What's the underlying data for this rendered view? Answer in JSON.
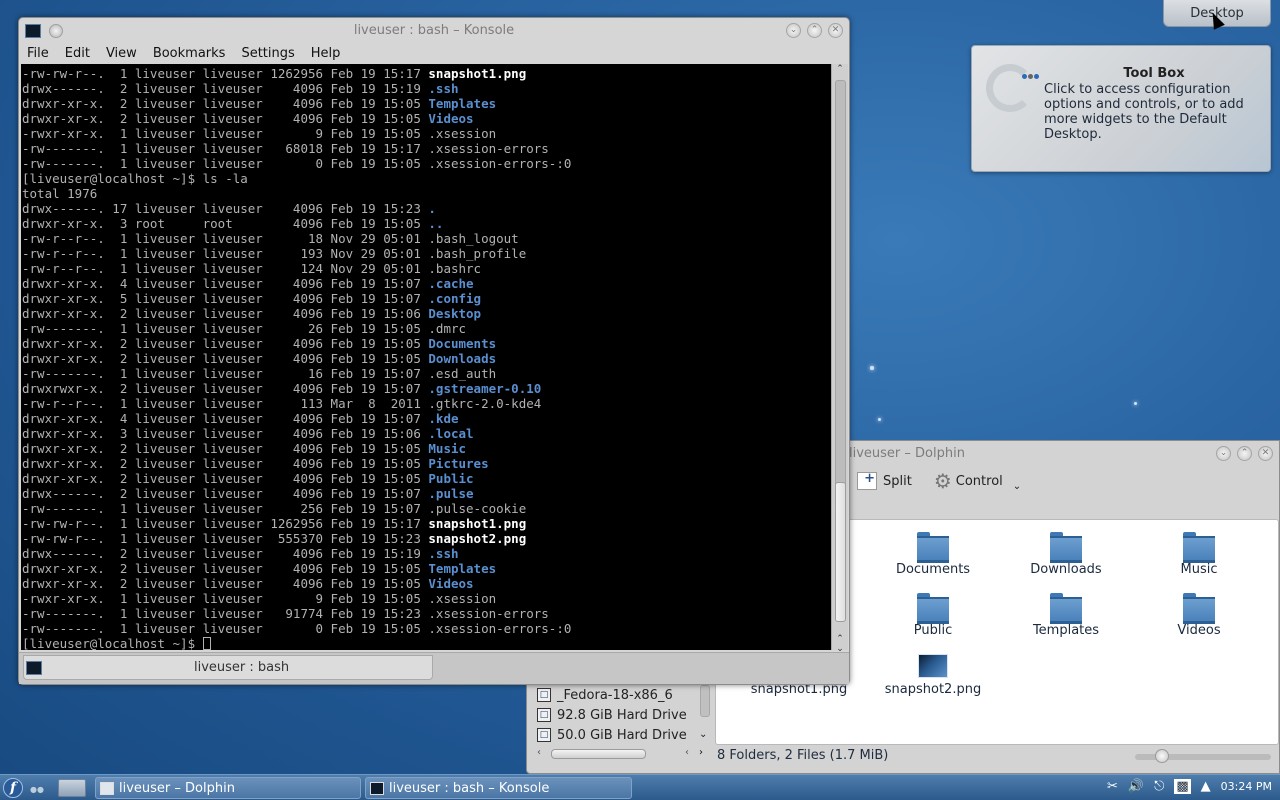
{
  "desktop": {
    "cashew_label": "Desktop",
    "toolbox": {
      "title": "Tool Box",
      "text": "Click to access configuration options and controls, or to add more widgets to the Default Desktop."
    }
  },
  "konsole": {
    "title": "liveuser : bash – Konsole",
    "menu": [
      "File",
      "Edit",
      "View",
      "Bookmarks",
      "Settings",
      "Help"
    ],
    "tab_label": "liveuser : bash",
    "lines": [
      {
        "t": "-rw-rw-r--.  1 liveuser liveuser 1262956 Feb 19 15:17 ",
        "n": "snapshot1.png",
        "k": "bold"
      },
      {
        "t": "drwx------.  2 liveuser liveuser    4096 Feb 19 15:19 ",
        "n": ".ssh",
        "k": "dir"
      },
      {
        "t": "drwxr-xr-x.  2 liveuser liveuser    4096 Feb 19 15:05 ",
        "n": "Templates",
        "k": "dir"
      },
      {
        "t": "drwxr-xr-x.  2 liveuser liveuser    4096 Feb 19 15:05 ",
        "n": "Videos",
        "k": "dir"
      },
      {
        "t": "-rwxr-xr-x.  1 liveuser liveuser       9 Feb 19 15:05 ",
        "n": ".xsession",
        "k": ""
      },
      {
        "t": "-rw-------.  1 liveuser liveuser   68018 Feb 19 15:17 ",
        "n": ".xsession-errors",
        "k": ""
      },
      {
        "t": "-rw-------.  1 liveuser liveuser       0 Feb 19 15:05 ",
        "n": ".xsession-errors-:0",
        "k": ""
      },
      {
        "t": "[liveuser@localhost ~]$ ls -la",
        "n": "",
        "k": ""
      },
      {
        "t": "total 1976",
        "n": "",
        "k": ""
      },
      {
        "t": "drwx------. 17 liveuser liveuser    4096 Feb 19 15:23 ",
        "n": ".",
        "k": "dir"
      },
      {
        "t": "drwxr-xr-x.  3 root     root        4096 Feb 19 15:05 ",
        "n": "..",
        "k": "dir"
      },
      {
        "t": "-rw-r--r--.  1 liveuser liveuser      18 Nov 29 05:01 ",
        "n": ".bash_logout",
        "k": ""
      },
      {
        "t": "-rw-r--r--.  1 liveuser liveuser     193 Nov 29 05:01 ",
        "n": ".bash_profile",
        "k": ""
      },
      {
        "t": "-rw-r--r--.  1 liveuser liveuser     124 Nov 29 05:01 ",
        "n": ".bashrc",
        "k": ""
      },
      {
        "t": "drwxr-xr-x.  4 liveuser liveuser    4096 Feb 19 15:07 ",
        "n": ".cache",
        "k": "dir"
      },
      {
        "t": "drwxr-xr-x.  5 liveuser liveuser    4096 Feb 19 15:07 ",
        "n": ".config",
        "k": "dir"
      },
      {
        "t": "drwxr-xr-x.  2 liveuser liveuser    4096 Feb 19 15:06 ",
        "n": "Desktop",
        "k": "dir"
      },
      {
        "t": "-rw-------.  1 liveuser liveuser      26 Feb 19 15:05 ",
        "n": ".dmrc",
        "k": ""
      },
      {
        "t": "drwxr-xr-x.  2 liveuser liveuser    4096 Feb 19 15:05 ",
        "n": "Documents",
        "k": "dir"
      },
      {
        "t": "drwxr-xr-x.  2 liveuser liveuser    4096 Feb 19 15:05 ",
        "n": "Downloads",
        "k": "dir"
      },
      {
        "t": "-rw-------.  1 liveuser liveuser      16 Feb 19 15:07 ",
        "n": ".esd_auth",
        "k": ""
      },
      {
        "t": "drwxrwxr-x.  2 liveuser liveuser    4096 Feb 19 15:07 ",
        "n": ".gstreamer-0.10",
        "k": "dir"
      },
      {
        "t": "-rw-r--r--.  1 liveuser liveuser     113 Mar  8  2011 ",
        "n": ".gtkrc-2.0-kde4",
        "k": ""
      },
      {
        "t": "drwxr-xr-x.  4 liveuser liveuser    4096 Feb 19 15:07 ",
        "n": ".kde",
        "k": "dir"
      },
      {
        "t": "drwxr-xr-x.  3 liveuser liveuser    4096 Feb 19 15:06 ",
        "n": ".local",
        "k": "dir"
      },
      {
        "t": "drwxr-xr-x.  2 liveuser liveuser    4096 Feb 19 15:05 ",
        "n": "Music",
        "k": "dir"
      },
      {
        "t": "drwxr-xr-x.  2 liveuser liveuser    4096 Feb 19 15:05 ",
        "n": "Pictures",
        "k": "dir"
      },
      {
        "t": "drwxr-xr-x.  2 liveuser liveuser    4096 Feb 19 15:05 ",
        "n": "Public",
        "k": "dir"
      },
      {
        "t": "drwx------.  2 liveuser liveuser    4096 Feb 19 15:07 ",
        "n": ".pulse",
        "k": "dir"
      },
      {
        "t": "-rw-------.  1 liveuser liveuser     256 Feb 19 15:07 ",
        "n": ".pulse-cookie",
        "k": ""
      },
      {
        "t": "-rw-rw-r--.  1 liveuser liveuser 1262956 Feb 19 15:17 ",
        "n": "snapshot1.png",
        "k": "bold"
      },
      {
        "t": "-rw-rw-r--.  1 liveuser liveuser  555370 Feb 19 15:23 ",
        "n": "snapshot2.png",
        "k": "bold"
      },
      {
        "t": "drwx------.  2 liveuser liveuser    4096 Feb 19 15:19 ",
        "n": ".ssh",
        "k": "dir"
      },
      {
        "t": "drwxr-xr-x.  2 liveuser liveuser    4096 Feb 19 15:05 ",
        "n": "Templates",
        "k": "dir"
      },
      {
        "t": "drwxr-xr-x.  2 liveuser liveuser    4096 Feb 19 15:05 ",
        "n": "Videos",
        "k": "dir"
      },
      {
        "t": "-rwxr-xr-x.  1 liveuser liveuser       9 Feb 19 15:05 ",
        "n": ".xsession",
        "k": ""
      },
      {
        "t": "-rw-------.  1 liveuser liveuser   91774 Feb 19 15:23 ",
        "n": ".xsession-errors",
        "k": ""
      },
      {
        "t": "-rw-------.  1 liveuser liveuser       0 Feb 19 15:05 ",
        "n": ".xsession-errors-:0",
        "k": ""
      }
    ],
    "prompt": "[liveuser@localhost ~]$ "
  },
  "dolphin": {
    "title": "liveuser – Dolphin",
    "toolbar": {
      "split": "Split",
      "control": "Control"
    },
    "places": [
      "_Fedora-18-x86_6",
      "92.8 GiB Hard Drive",
      "50.0 GiB Hard Drive"
    ],
    "folders": [
      "Documents",
      "Downloads",
      "Music",
      "Public",
      "Templates",
      "Videos"
    ],
    "files": [
      "snapshot1.png",
      "snapshot2.png"
    ],
    "status": "8 Folders, 2 Files (1.7 MiB)"
  },
  "taskbar": {
    "tasks": [
      "liveuser – Dolphin",
      "liveuser : bash – Konsole"
    ],
    "clock": "03:24 PM"
  }
}
